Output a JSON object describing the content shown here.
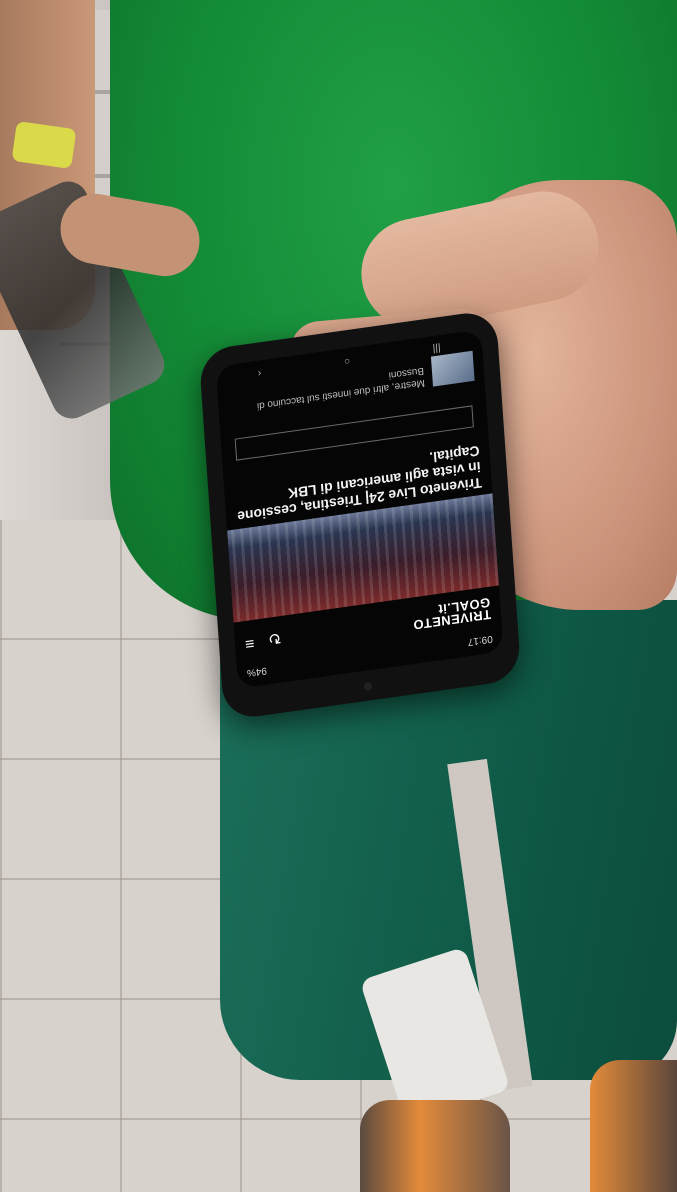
{
  "status": {
    "time": "09:17",
    "battery": "94%"
  },
  "site": {
    "logo_line1": "TRIVENETO",
    "logo_line2": "GOAL.it"
  },
  "header_icons": {
    "refresh": "↻",
    "menu": "≡"
  },
  "headline": "Triveneto Live 24| Triestina, cessione in vista agli americani di LBK Capital.",
  "article2": {
    "text": "Mestre, altri due innesti sul taccuino di Bussoni"
  },
  "navbar": {
    "recent": "|||",
    "home": "○",
    "back": "‹"
  }
}
